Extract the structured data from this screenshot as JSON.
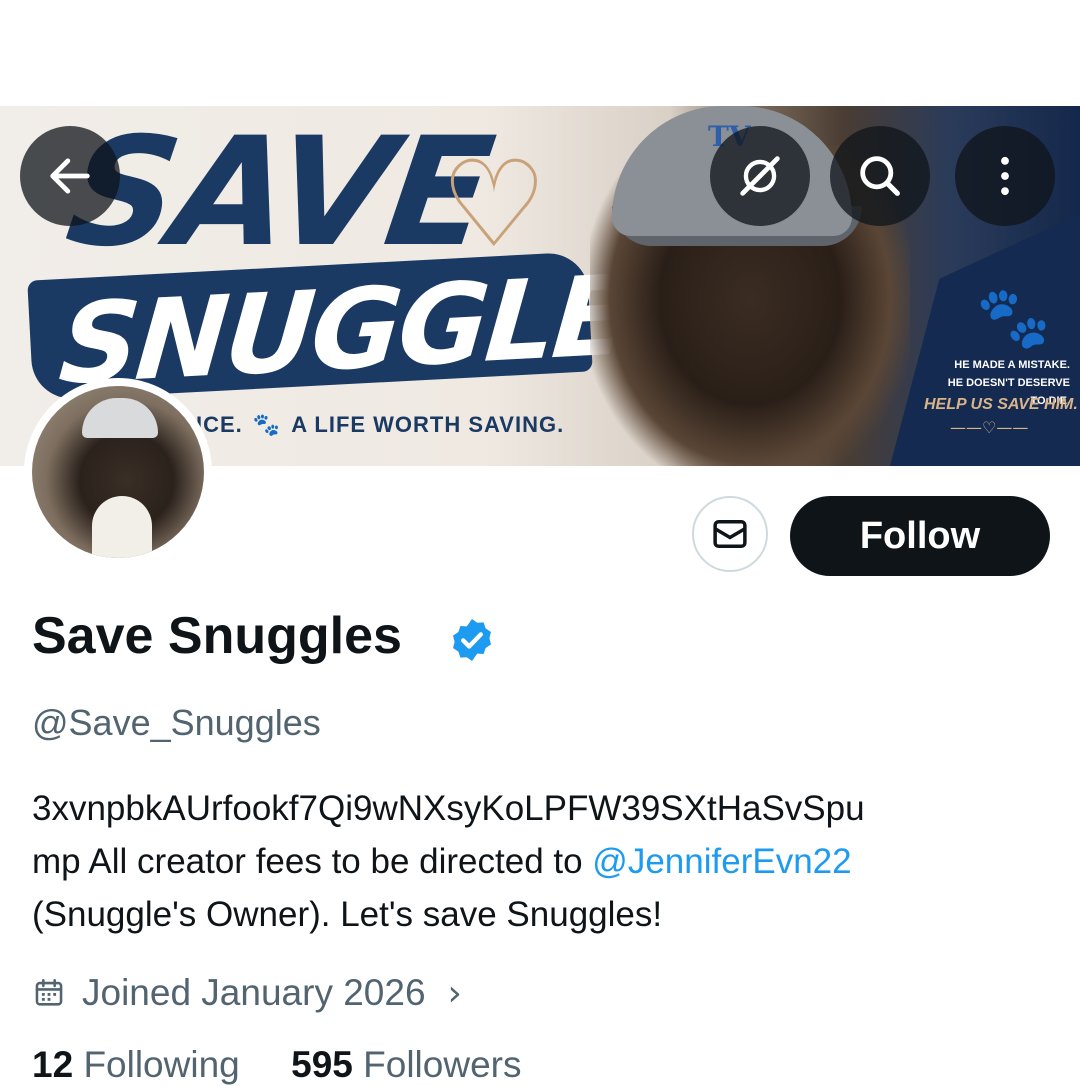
{
  "banner": {
    "headline_top": "SAVE",
    "headline_bottom": "SNUGGLES",
    "tagline_left": "ICE.",
    "tagline_right": "A LIFE WORTH SAVING.",
    "side_line1": "HE MADE A MISTAKE.",
    "side_line2": "HE DOESN'T DESERVE TO DIE.",
    "help": "HELP US SAVE HIM.",
    "cap_letters": "TV"
  },
  "nav": {
    "back_icon": "back-arrow-icon",
    "grok_icon": "grok-icon",
    "search_icon": "search-icon",
    "more_icon": "more-vertical-icon"
  },
  "profile": {
    "name": "Save Snuggles",
    "handle": "@Save_Snuggles",
    "bio_line1": "3xvnpbkAUrfookf7Qi9wNXsyKoLPFW39SXtHaSvSpu",
    "bio_line2_prefix": "mp All creator fees to be directed to ",
    "bio_mention": "@JenniferEvn22",
    "bio_line3": "(Snuggle's Owner). Let's save Snuggles!",
    "joined": "Joined January 2026",
    "following_count": "12",
    "following_label": "Following",
    "followers_count": "595",
    "followers_label": "Followers"
  },
  "actions": {
    "follow_label": "Follow"
  },
  "colors": {
    "accent": "#1d9bf0",
    "text": "#0f1419",
    "muted": "#536471",
    "button": "#0f1419"
  }
}
